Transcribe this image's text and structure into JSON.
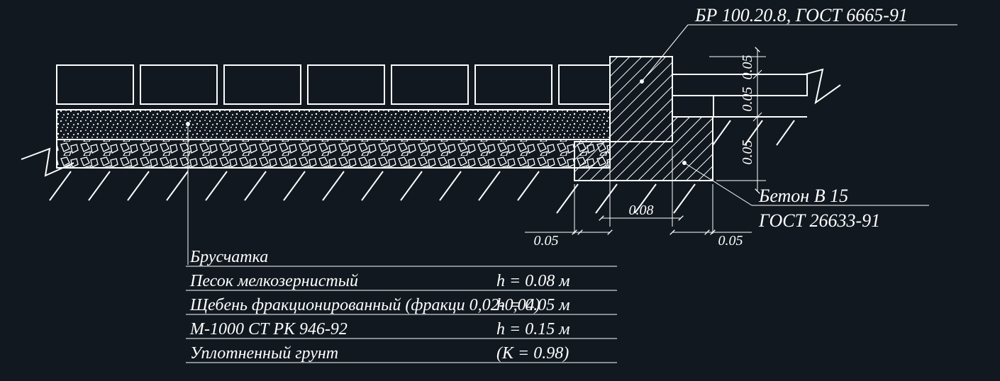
{
  "callouts": {
    "kerb": "БР 100.20.8, ГОСТ 6665-91",
    "concrete_line1": "Бетон В 15",
    "concrete_line2": "ГОСТ 26633-91"
  },
  "dimensions": {
    "top_vert": "0.05",
    "mid_vert": "0.05",
    "bot_vert": "0.05",
    "horiz_left": "0.05",
    "horiz_mid": "0.08",
    "horiz_right": "0.05"
  },
  "legend": {
    "rows": [
      {
        "material": "Брусчатка",
        "value": ""
      },
      {
        "material": "Песок мелкозернистый",
        "value": "h = 0.08 м"
      },
      {
        "material": "Щебень фракционированный (фракци 0,02-0,04)",
        "value": "h = 0.05 м"
      },
      {
        "material": "М-1000  СТ РК 946-92",
        "value": "h = 0.15 м"
      },
      {
        "material": "Уплотненный грунт",
        "value": "(K = 0.98)"
      }
    ]
  }
}
